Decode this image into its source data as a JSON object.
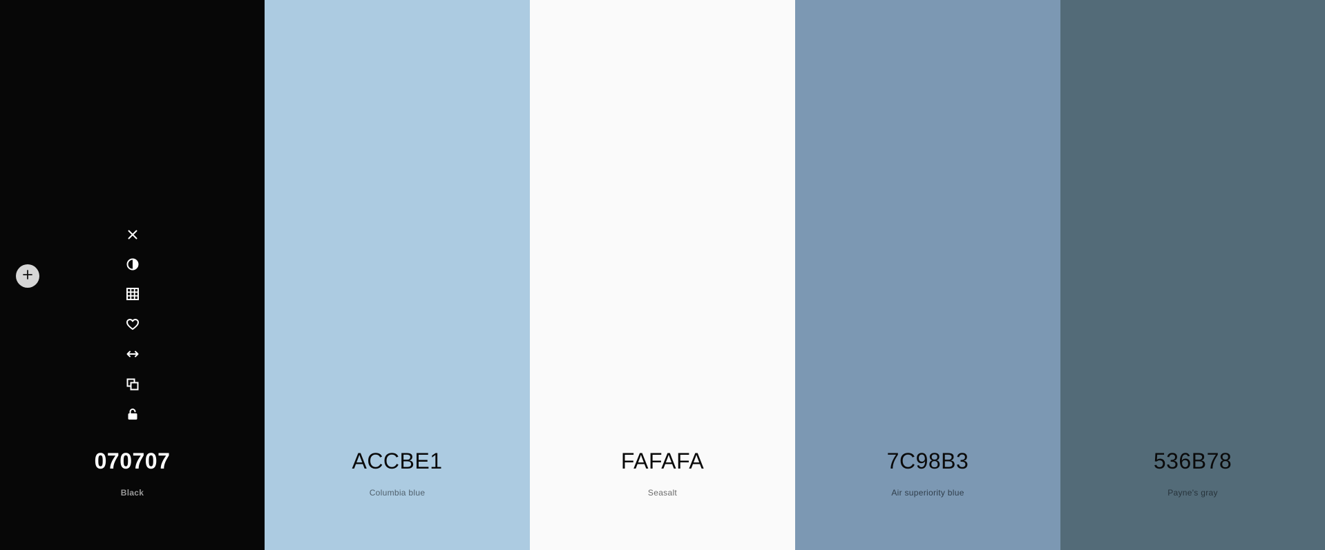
{
  "swatches": [
    {
      "hex": "070707",
      "name": "Black",
      "color": "#070707",
      "text_color": "#ffffff",
      "name_color": "#9a9a9a"
    },
    {
      "hex": "ACCBE1",
      "name": "Columbia blue",
      "color": "#ACCBE1",
      "text_color": "#0a0a0a",
      "name_color": "#4f5f6b"
    },
    {
      "hex": "FAFAFA",
      "name": "Seasalt",
      "color": "#FAFAFA",
      "text_color": "#0a0a0a",
      "name_color": "#6b6b6b"
    },
    {
      "hex": "7C98B3",
      "name": "Air superiority blue",
      "color": "#7C98B3",
      "text_color": "#0a0a0a",
      "name_color": "#2f3d4a"
    },
    {
      "hex": "536B78",
      "name": "Payne's gray",
      "color": "#536B78",
      "text_color": "#0a0a0a",
      "name_color": "#26323a"
    }
  ],
  "tools": [
    {
      "icon": "close-icon"
    },
    {
      "icon": "contrast-icon"
    },
    {
      "icon": "grid-icon"
    },
    {
      "icon": "heart-icon"
    },
    {
      "icon": "drag-arrows-icon"
    },
    {
      "icon": "copy-icon"
    },
    {
      "icon": "unlock-icon"
    }
  ],
  "add_button": {
    "icon": "plus-icon",
    "background": "#d6d6d6"
  }
}
